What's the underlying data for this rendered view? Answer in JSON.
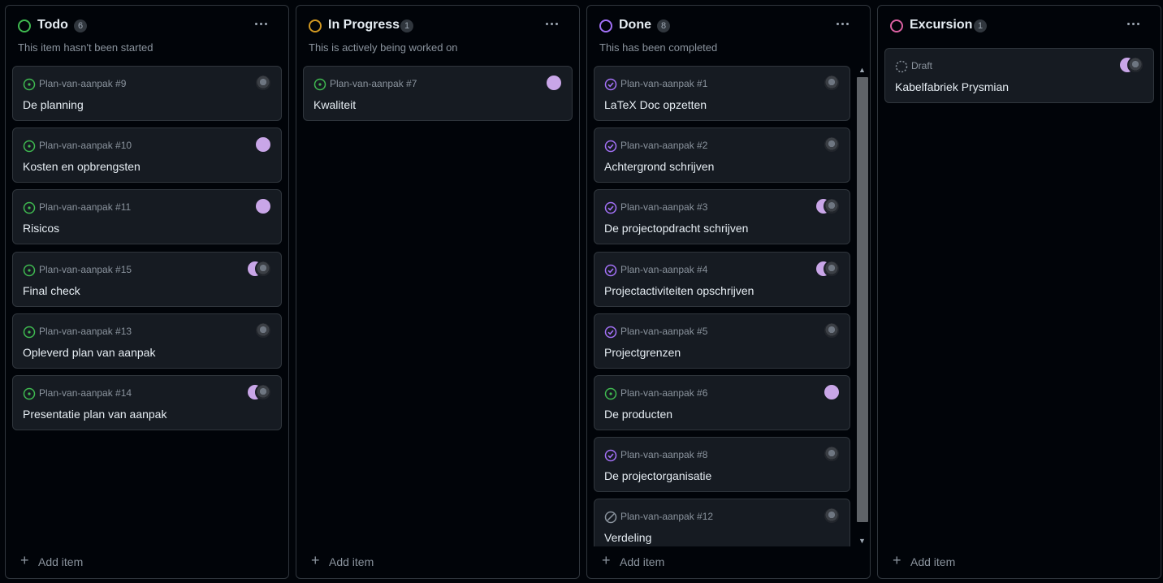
{
  "columns": [
    {
      "title": "Todo",
      "count": "6",
      "status_color": "#3fb950",
      "description": "This item hasn't been started",
      "menu_icon": "kebab-horizontal-icon",
      "add_label": "Add item",
      "cards": [
        {
          "ref": "Plan-van-aanpak #9",
          "title": "De planning",
          "state": "open",
          "assignees": [
            "dark"
          ]
        },
        {
          "ref": "Plan-van-aanpak #10",
          "title": "Kosten en opbrengsten",
          "state": "open",
          "assignees": [
            "pink"
          ]
        },
        {
          "ref": "Plan-van-aanpak #11",
          "title": "Risicos",
          "state": "open",
          "assignees": [
            "pink"
          ]
        },
        {
          "ref": "Plan-van-aanpak #15",
          "title": "Final check",
          "state": "open",
          "assignees": [
            "pink",
            "dark"
          ]
        },
        {
          "ref": "Plan-van-aanpak #13",
          "title": "Opleverd plan van aanpak",
          "state": "open",
          "assignees": [
            "dark"
          ]
        },
        {
          "ref": "Plan-van-aanpak #14",
          "title": "Presentatie plan van aanpak",
          "state": "open",
          "assignees": [
            "pink",
            "dark"
          ]
        }
      ]
    },
    {
      "title": "In Progress",
      "count": "1",
      "status_color": "#d29922",
      "description": "This is actively being worked on",
      "menu_icon": "kebab-horizontal-icon",
      "add_label": "Add item",
      "cards": [
        {
          "ref": "Plan-van-aanpak #7",
          "title": "Kwaliteit",
          "state": "open",
          "assignees": [
            "pink"
          ]
        }
      ]
    },
    {
      "title": "Done",
      "count": "8",
      "status_color": "#a371f7",
      "description": "This has been completed",
      "menu_icon": "kebab-horizontal-icon",
      "add_label": "Add item",
      "cards": [
        {
          "ref": "Plan-van-aanpak #1",
          "title": "LaTeX Doc opzetten",
          "state": "closed",
          "assignees": [
            "dark"
          ]
        },
        {
          "ref": "Plan-van-aanpak #2",
          "title": "Achtergrond schrijven",
          "state": "closed",
          "assignees": [
            "dark"
          ]
        },
        {
          "ref": "Plan-van-aanpak #3",
          "title": "De projectopdracht schrijven",
          "state": "closed",
          "assignees": [
            "pink",
            "dark"
          ]
        },
        {
          "ref": "Plan-van-aanpak #4",
          "title": "Projectactiviteiten opschrijven",
          "state": "closed",
          "assignees": [
            "pink",
            "dark"
          ]
        },
        {
          "ref": "Plan-van-aanpak #5",
          "title": "Projectgrenzen",
          "state": "closed",
          "assignees": [
            "dark"
          ]
        },
        {
          "ref": "Plan-van-aanpak #6",
          "title": "De producten",
          "state": "open",
          "assignees": [
            "pink"
          ]
        },
        {
          "ref": "Plan-van-aanpak #8",
          "title": "De projectorganisatie",
          "state": "closed",
          "assignees": [
            "dark"
          ]
        },
        {
          "ref": "Plan-van-aanpak #12",
          "title": "Verdeling",
          "state": "not-planned",
          "assignees": [
            "dark"
          ]
        }
      ]
    },
    {
      "title": "Excursion",
      "count": "1",
      "status_color": "#db61a2",
      "description": "",
      "menu_icon": "kebab-horizontal-icon",
      "add_label": "Add item",
      "cards": [
        {
          "ref": "Draft",
          "title": "Kabelfabriek Prysmian",
          "state": "draft",
          "assignees": [
            "pink",
            "dark"
          ]
        }
      ]
    }
  ],
  "colors": {
    "open": "#3fb950",
    "closed": "#a371f7",
    "not_planned": "#8b949e",
    "draft": "#8b949e",
    "background": "#010409",
    "card": "#161b22",
    "border": "#30363d"
  },
  "icons": {
    "open": "issue-opened-icon",
    "closed": "issue-closed-icon",
    "not-planned": "issue-not-planned-icon",
    "draft": "issue-draft-icon",
    "add": "plus-icon"
  }
}
